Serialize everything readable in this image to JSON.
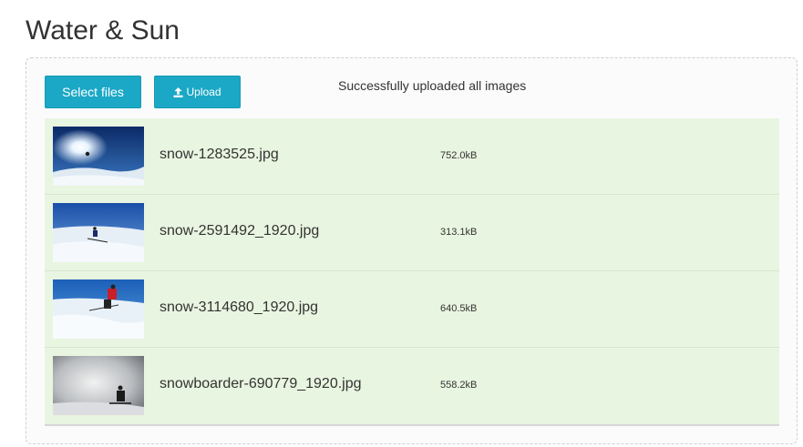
{
  "page": {
    "title": "Water & Sun"
  },
  "toolbar": {
    "select_label": "Select files",
    "upload_label": "Upload",
    "upload_icon": "upload-icon"
  },
  "status": {
    "message": "Successfully uploaded all images"
  },
  "colors": {
    "button_bg": "#1ba8c6",
    "row_success_bg": "#e8f5e0"
  },
  "files": [
    {
      "name": "snow-1283525.jpg",
      "size": "752.0kB"
    },
    {
      "name": "snow-2591492_1920.jpg",
      "size": "313.1kB"
    },
    {
      "name": "snow-3114680_1920.jpg",
      "size": "640.5kB"
    },
    {
      "name": "snowboarder-690779_1920.jpg",
      "size": "558.2kB"
    }
  ]
}
